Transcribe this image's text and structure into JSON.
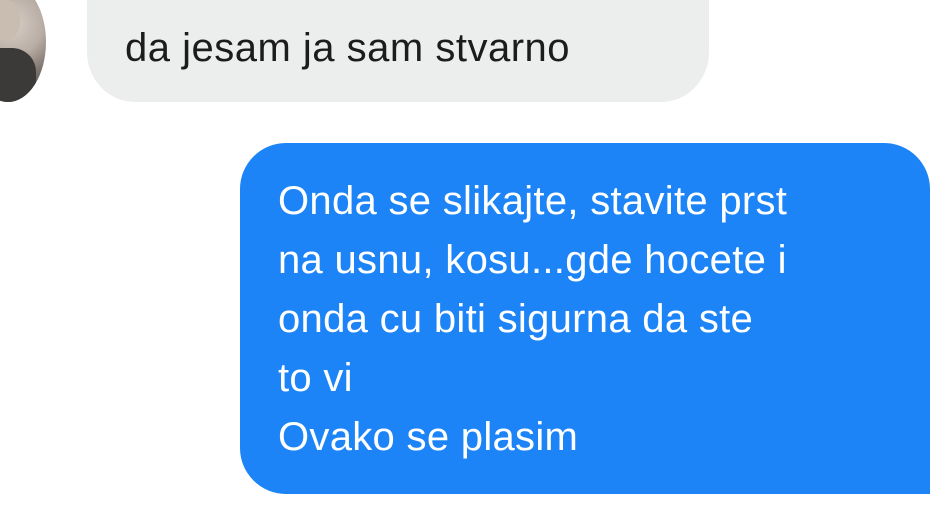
{
  "conversation": {
    "incoming_message": {
      "text": "da jesam ja sam stvarno"
    },
    "outgoing_message": {
      "lines": [
        "Onda se slikajte, stavite prst",
        "na usnu, kosu...gde hocete i",
        "onda cu biti sigurna da ste",
        "to vi",
        "Ovako se plasim"
      ]
    }
  },
  "colors": {
    "incoming_bubble": "#eceded",
    "outgoing_bubble": "#1c84f7",
    "incoming_text": "#1c1c1c",
    "outgoing_text": "#ffffff"
  },
  "icons": {
    "avatar": "contact-avatar-photo"
  }
}
